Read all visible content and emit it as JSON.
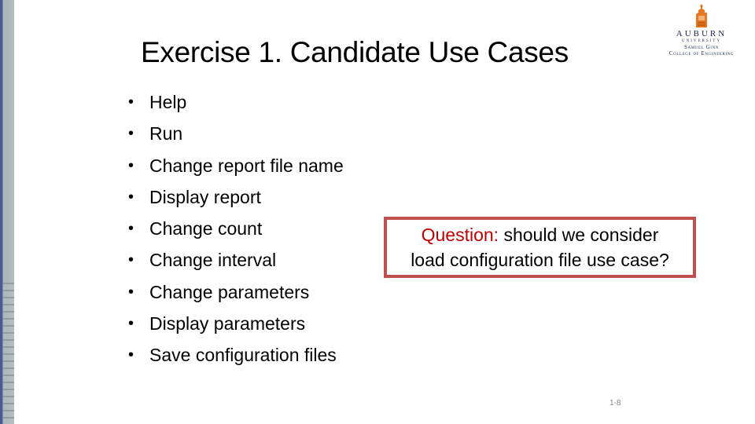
{
  "slide": {
    "title": "Exercise 1. Candidate Use Cases",
    "bullet_glyph": "•",
    "bullets": [
      "Help",
      "Run",
      "Change report file name",
      "Display report",
      "Change count",
      "Change interval",
      "Change parameters",
      "Display parameters",
      "Save configuration files"
    ],
    "question": {
      "label": "Question:",
      "line1_rest": " should we consider",
      "line2": "load configuration file use case?"
    },
    "page_number": "1-8"
  },
  "logo": {
    "icon": "auburn-tower-icon",
    "name": "AUBURN",
    "subtitle": "UNIVERSITY",
    "college_line1": "Samuel Ginn",
    "college_line2": "College of Engineering"
  },
  "colors": {
    "question_label": "#c00000",
    "box_border": "#c0504d",
    "logo_orange": "#e87722",
    "logo_navy": "#1a2a50",
    "strip_blue": "#4a5a8f"
  }
}
